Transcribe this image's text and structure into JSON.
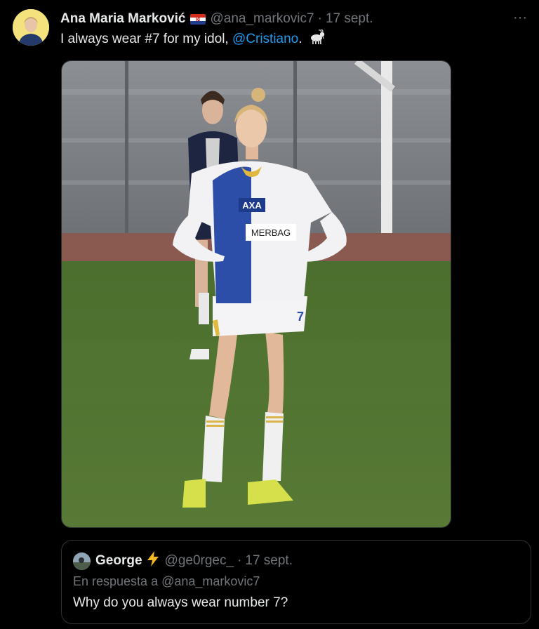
{
  "tweet": {
    "author_name": "Ana Maria Marković",
    "author_handle": "@ana_markovic7",
    "separator": "·",
    "date": "17 sept.",
    "text_before": "I always wear #7 for my idol, ",
    "mention": "@Cristiano",
    "text_after": ".",
    "emoji_icon": "goat-icon",
    "flag_icon": "croatia-flag-icon",
    "more_label": "···",
    "image": {
      "jersey_logo": "AXA",
      "jersey_sponsor": "MERBAG",
      "shorts_number": "7"
    }
  },
  "quote": {
    "author_name": "George",
    "bolt_icon": "lightning-bolt-icon",
    "author_handle": "@ge0rgec_",
    "separator": "·",
    "date": "17 sept.",
    "reply_prefix": "En respuesta a ",
    "reply_to": "@ana_markovic7",
    "text": "Why do you always wear number 7?"
  },
  "colors": {
    "background": "#000000",
    "primary_text": "#e7e9ea",
    "secondary_text": "#71767b",
    "link": "#1d9bf0",
    "border": "#2f3336"
  }
}
